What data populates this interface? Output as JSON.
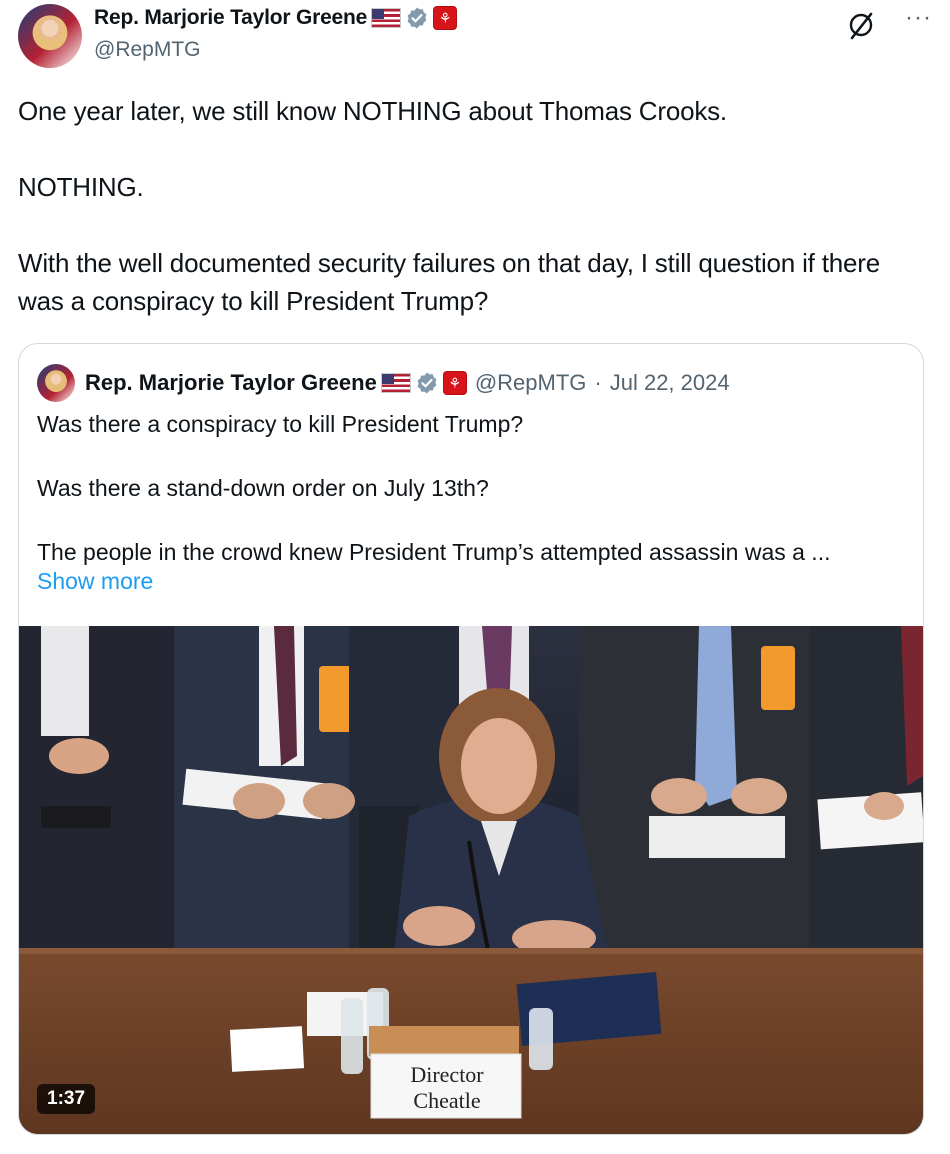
{
  "author": {
    "name": "Rep. Marjorie Taylor Greene",
    "handle": "@RepMTG",
    "flag_icon": "us-flag-icon",
    "verified_icon": "verified-badge-icon",
    "affiliation_icon": "house-seal-icon"
  },
  "header_actions": {
    "grok_icon": "grok-icon",
    "more_label": "···"
  },
  "tweet": {
    "text": "One year later, we still know NOTHING about Thomas Crooks.\n\nNOTHING.\n\nWith the well documented security failures on that day, I still question if there was a conspiracy to kill President Trump?"
  },
  "quote": {
    "name": "Rep. Marjorie Taylor Greene",
    "handle": "@RepMTG",
    "separator": "·",
    "date": "Jul 22, 2024",
    "text": "Was there a conspiracy to kill President Trump?\n\nWas there a stand-down order on July 13th?\n\nThe people in the crowd knew President Trump’s attempted assassin was a ...",
    "show_more": "Show more",
    "video": {
      "duration": "1:37",
      "placard_line1": "Director",
      "placard_line2": "Cheatle"
    }
  },
  "colors": {
    "link": "#1d9bf0",
    "secondary_text": "#536471",
    "border": "#cfd9de",
    "verified": "#829aab"
  }
}
